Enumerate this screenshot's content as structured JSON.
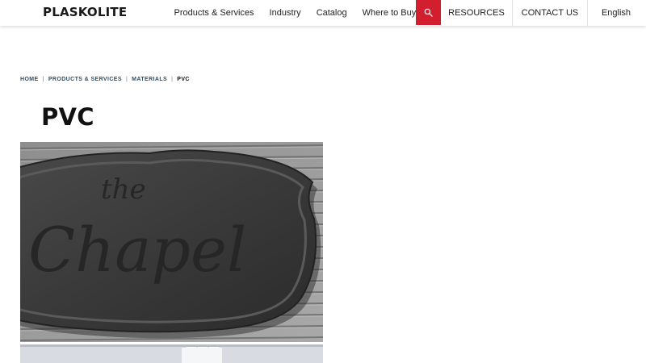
{
  "brand": {
    "logo_text": "PLASKOLITE"
  },
  "nav": {
    "main": [
      "Products & Services",
      "Industry",
      "Catalog",
      "Where to Buy"
    ],
    "search_icon": "search-icon",
    "right": [
      "RESOURCES",
      "CONTACT US",
      "English"
    ]
  },
  "colors": {
    "accent": "#d21f2f",
    "breadcrumb_link": "#2f4f6a"
  },
  "breadcrumb": {
    "items": [
      "HOME",
      "PRODUCTS & SERVICES",
      "MATERIALS"
    ],
    "current": "PVC",
    "separator": "|"
  },
  "page": {
    "title": "PVC"
  },
  "hero": {
    "sign_text_top": "the",
    "sign_text_main": "Chapel"
  }
}
